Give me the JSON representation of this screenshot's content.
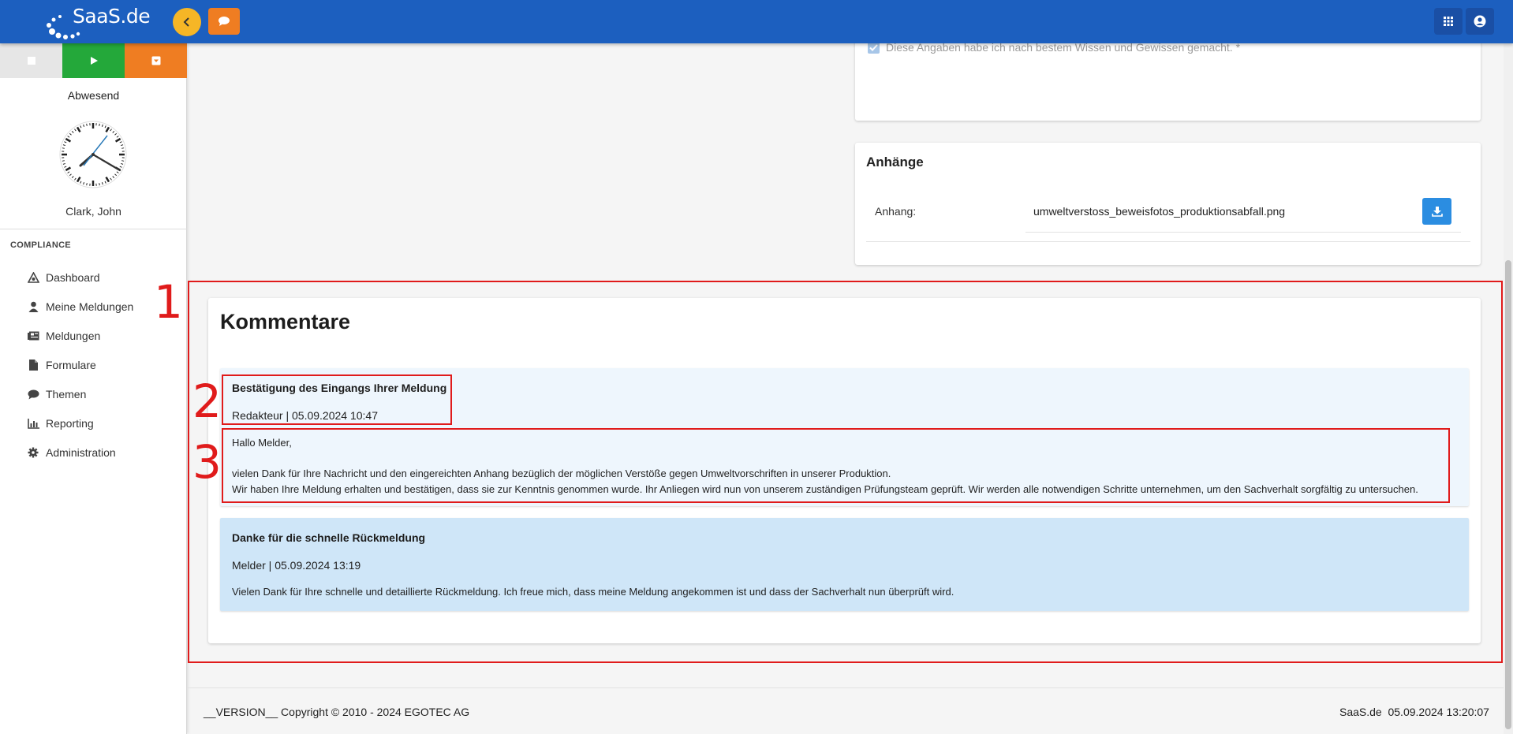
{
  "app": {
    "logo_text": "SaaS.de"
  },
  "sidebar": {
    "status": "Abwesend",
    "user": "Clark, John",
    "section": "COMPLIANCE",
    "items": [
      {
        "label": "Dashboard",
        "icon": "dashboard-icon"
      },
      {
        "label": "Meine Meldungen",
        "icon": "person-icon"
      },
      {
        "label": "Meldungen",
        "icon": "reports-icon"
      },
      {
        "label": "Formulare",
        "icon": "file-icon"
      },
      {
        "label": "Themen",
        "icon": "speech-bubble-icon"
      },
      {
        "label": "Reporting",
        "icon": "bar-chart-icon"
      },
      {
        "label": "Administration",
        "icon": "gear-icon"
      }
    ]
  },
  "form": {
    "confirm_text": "Diese Angaben habe ich nach bestem Wissen und Gewissen gemacht. *"
  },
  "attachments": {
    "title": "Anhänge",
    "label": "Anhang:",
    "file": "umweltverstoss_beweisfotos_produktionsabfall.png"
  },
  "annotations": [
    "1",
    "2",
    "3"
  ],
  "comments": {
    "title": "Kommentare",
    "items": [
      {
        "title": "Bestätigung des Eingangs Ihrer Meldung",
        "meta": "Redakteur | 05.09.2024 10:47",
        "greeting": "Hallo Melder,",
        "line1": "vielen Dank für Ihre Nachricht und den eingereichten Anhang bezüglich der möglichen Verstöße gegen Umweltvorschriften in unserer Produktion.",
        "line2": "Wir haben Ihre Meldung erhalten und bestätigen, dass sie zur Kenntnis genommen wurde. Ihr Anliegen wird nun von unserem zuständigen Prüfungsteam geprüft. Wir werden alle notwendigen Schritte unternehmen, um den Sachverhalt sorgfältig zu untersuchen."
      },
      {
        "title": "Danke für die schnelle Rückmeldung",
        "meta": "Melder | 05.09.2024 13:19",
        "line1": "Vielen Dank für Ihre schnelle und detaillierte Rückmeldung. Ich freue mich, dass meine Meldung angekommen ist und dass der Sachverhalt nun überprüft wird."
      }
    ]
  },
  "footer": {
    "left": "__VERSION__ Copyright © 2010 - 2024 EGOTEC AG",
    "right": "SaaS.de  05.09.2024 13:20:07"
  },
  "colors": {
    "topbar": "#1c5fbf",
    "accent_yellow": "#f6b626",
    "accent_orange": "#ef7d22",
    "accent_green": "#24a83a",
    "annotation_red": "#e01b1b"
  }
}
